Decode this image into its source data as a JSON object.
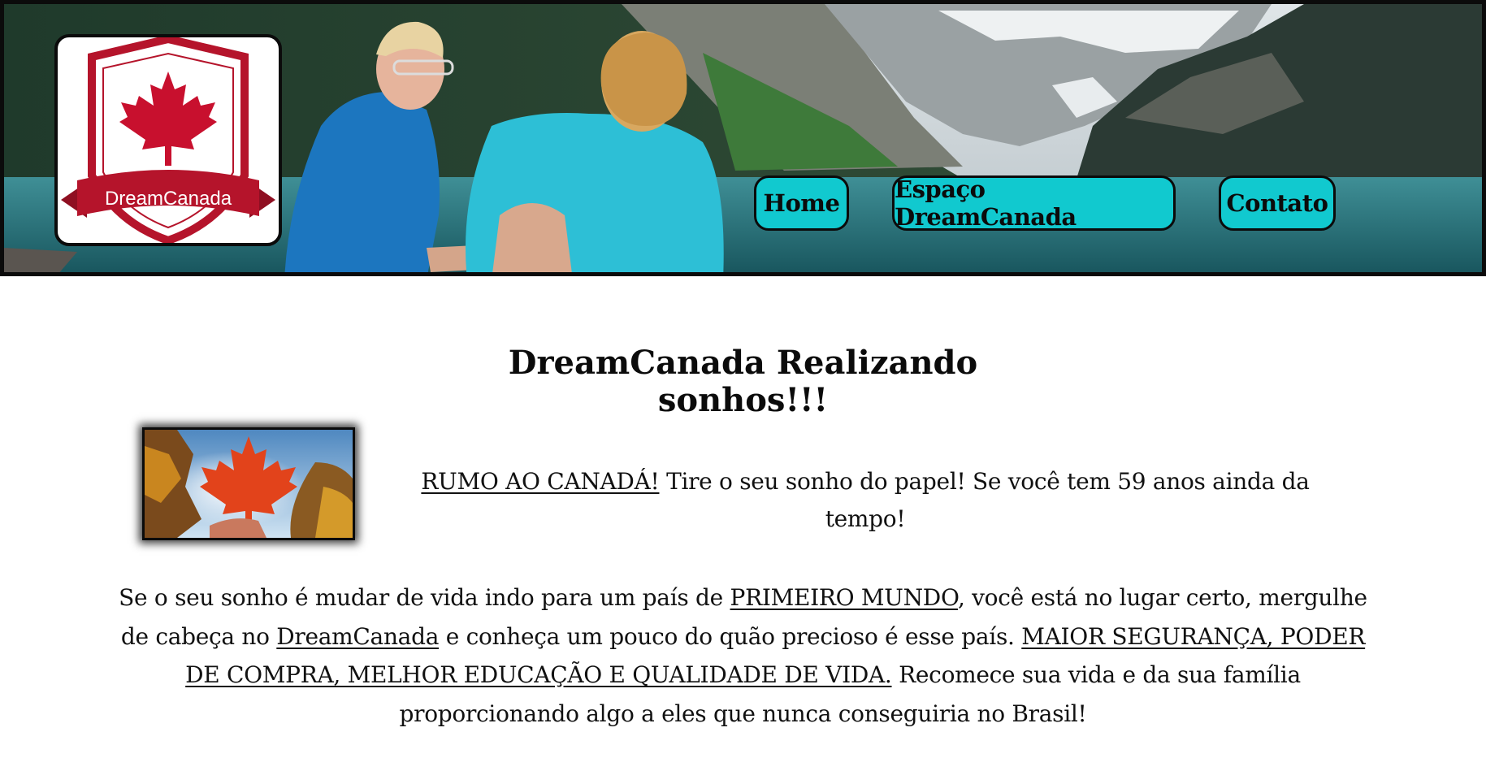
{
  "header": {
    "logo_text": "DreamCanada",
    "nav": [
      {
        "label": "Home"
      },
      {
        "label": "Espaço DreamCanada"
      },
      {
        "label": "Contato"
      }
    ]
  },
  "main": {
    "title_line1": "DreamCanada Realizando",
    "title_line2": "sonhos!!!",
    "intro": {
      "highlight": "RUMO AO CANADÁ!",
      "text": " Tire o seu sonho do papel! Se você tem 59 anos ainda da tempo!"
    },
    "paragraph": {
      "part1": "Se o seu sonho é mudar de vida indo para um país de ",
      "link1": "PRIMEIRO MUNDO",
      "part2": ", você está no lugar certo, mergulhe de cabeça no ",
      "link2": "DreamCanada",
      "part3": " e conheça um pouco do quão precioso é esse país. ",
      "link3": "MAIOR SEGURANÇA, PODER DE COMPRA, MELHOR EDUCAÇÃO E QUALIDADE DE VIDA.",
      "part4": " Recomece sua vida e da sua família proporcionando algo a eles que nunca conseguiria no Brasil!"
    }
  },
  "colors": {
    "nav_button": "#11c9cf",
    "logo_red": "#b5142b",
    "border": "#0b0b0b"
  }
}
